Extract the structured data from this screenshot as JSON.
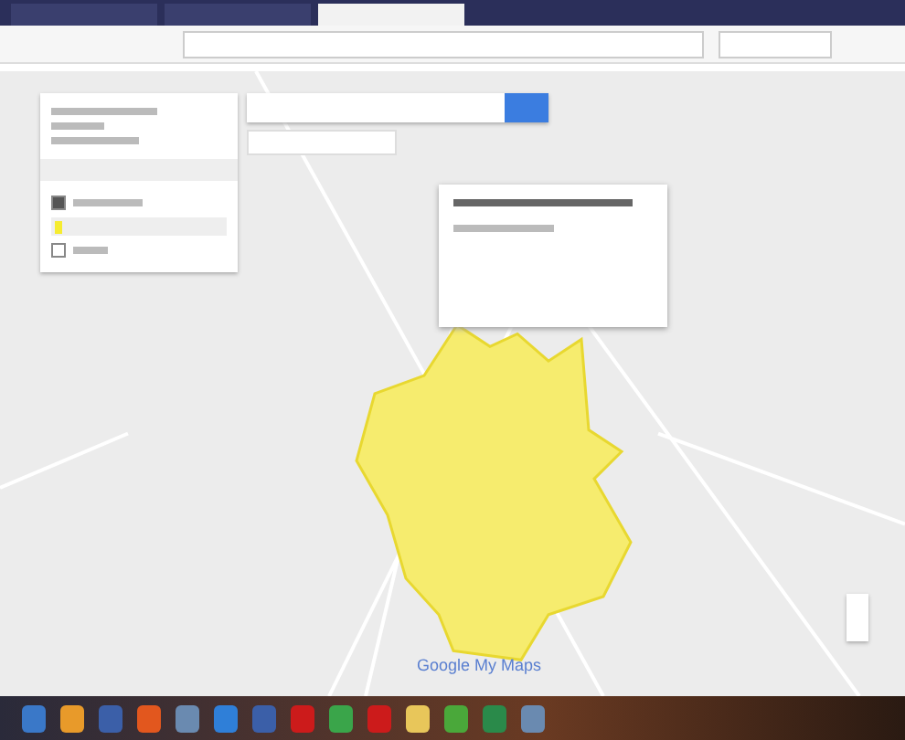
{
  "browser": {
    "tabs": [
      {
        "selected": false
      },
      {
        "selected": false
      },
      {
        "selected": true
      }
    ]
  },
  "map_panel": {
    "layer": {
      "checked": true
    },
    "base_layer": {
      "checked": false
    }
  },
  "map": {
    "branding": "Google My Maps"
  },
  "taskbar": {
    "icons": [
      {
        "kind": "start"
      },
      {
        "kind": "media"
      },
      {
        "kind": "docs"
      },
      {
        "kind": "firefox"
      },
      {
        "kind": "tools"
      },
      {
        "kind": "globe"
      },
      {
        "kind": "docs"
      },
      {
        "kind": "opera"
      },
      {
        "kind": "chrome"
      },
      {
        "kind": "opera"
      },
      {
        "kind": "folder"
      },
      {
        "kind": "torrent"
      },
      {
        "kind": "sheet"
      },
      {
        "kind": "tools"
      }
    ]
  }
}
